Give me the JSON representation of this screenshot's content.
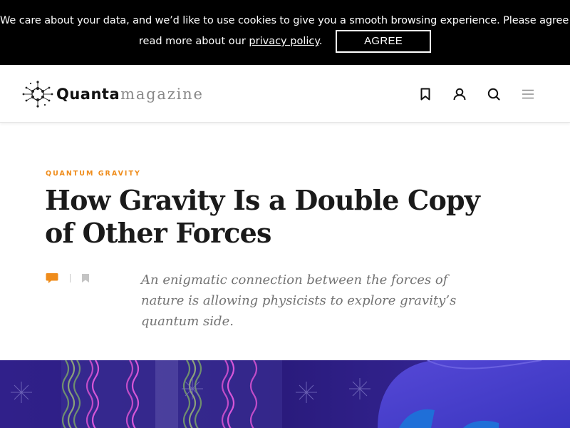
{
  "cookie_banner": {
    "message_line1": "We care about your data, and we’d like to use cookies to give you a smooth browsing experience. Please agree and",
    "message_line2_prefix": "read more about our ",
    "privacy_link": "privacy policy",
    "message_line2_suffix": ".",
    "agree_label": "AGREE"
  },
  "header": {
    "logo_primary": "Quanta",
    "logo_secondary": "magazine",
    "icons": [
      "bookmark-icon",
      "user-icon",
      "search-icon",
      "menu-icon"
    ]
  },
  "article": {
    "kicker": "QUANTUM GRAVITY",
    "title": "How Gravity Is a Double Copy of Other Forces",
    "dek": "An enigmatic connection between the forces of nature is allowing physicists to explore gravity’s quantum side."
  },
  "colors": {
    "accent": "#ef8c1b",
    "banner_bg": "#000000",
    "hero_bg": "#2a1d7a"
  }
}
